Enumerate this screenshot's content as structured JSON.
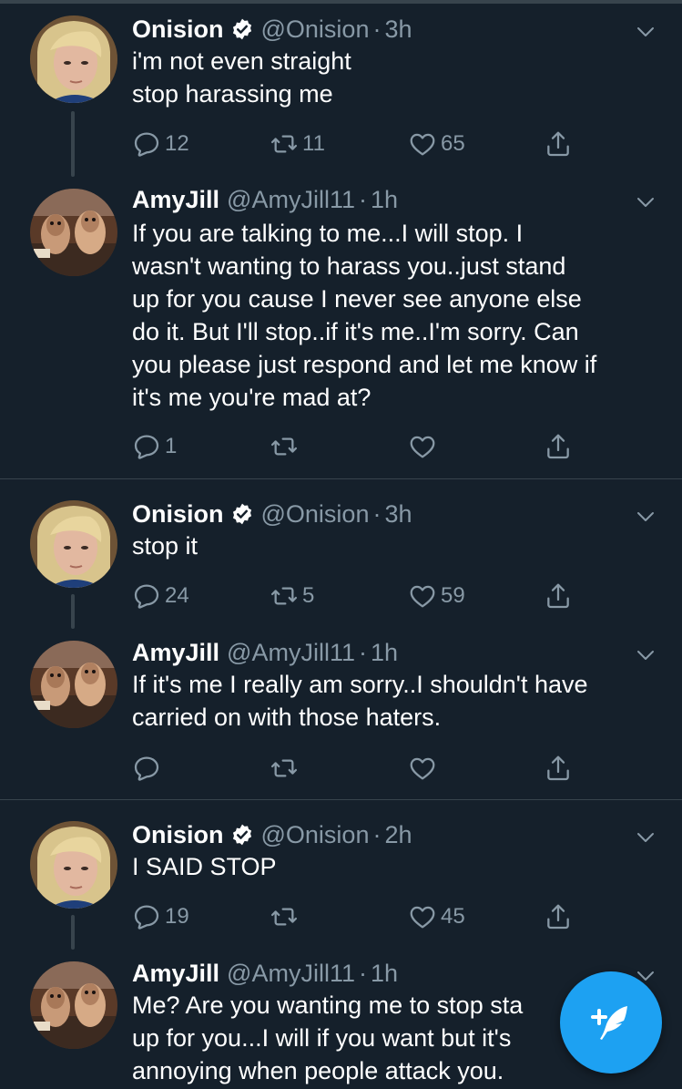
{
  "tweets": [
    {
      "name": "Onision",
      "verified": true,
      "handle": "@Onision",
      "time": "3h",
      "lines": [
        "i'm not even straight",
        "stop harassing me"
      ],
      "replies": "12",
      "retweets": "11",
      "likes": "65"
    },
    {
      "name": "AmyJill",
      "verified": false,
      "handle": "@AmyJill11",
      "time": "1h",
      "lines": [
        "If you are talking to me...I will stop. I",
        "wasn't wanting to harass you..just stand",
        "up for you cause I never see anyone else",
        "do it. But I'll stop..if it's me..I'm sorry. Can",
        "you please just respond and let me know if",
        "it's me you're mad at?"
      ],
      "replies": "1",
      "retweets": "",
      "likes": ""
    },
    {
      "name": "Onision",
      "verified": true,
      "handle": "@Onision",
      "time": "3h",
      "lines": [
        "stop it"
      ],
      "replies": "24",
      "retweets": "5",
      "likes": "59"
    },
    {
      "name": "AmyJill",
      "verified": false,
      "handle": "@AmyJill11",
      "time": "1h",
      "lines": [
        "If it's me I really am sorry..I shouldn't have",
        "carried on with those haters."
      ],
      "replies": "",
      "retweets": "",
      "likes": ""
    },
    {
      "name": "Onision",
      "verified": true,
      "handle": "@Onision",
      "time": "2h",
      "lines": [
        "I SAID STOP"
      ],
      "replies": "19",
      "retweets": "",
      "likes": "45"
    },
    {
      "name": "AmyJill",
      "verified": false,
      "handle": "@AmyJill11",
      "time": "1h",
      "lines": [
        "Me? Are you wanting me to stop sta",
        "up for you...I will if you want but it's",
        "annoying when people attack you."
      ]
    }
  ],
  "colors": {
    "background": "#15202b",
    "accent": "#1da1f2",
    "secondary_text": "#8899a6",
    "divider": "#38444d"
  },
  "icons": {
    "reply": "reply-icon",
    "retweet": "retweet-icon",
    "like": "heart-icon",
    "share": "share-icon",
    "verified": "verified-badge-icon",
    "more": "chevron-down-icon",
    "compose": "compose-tweet-icon"
  }
}
